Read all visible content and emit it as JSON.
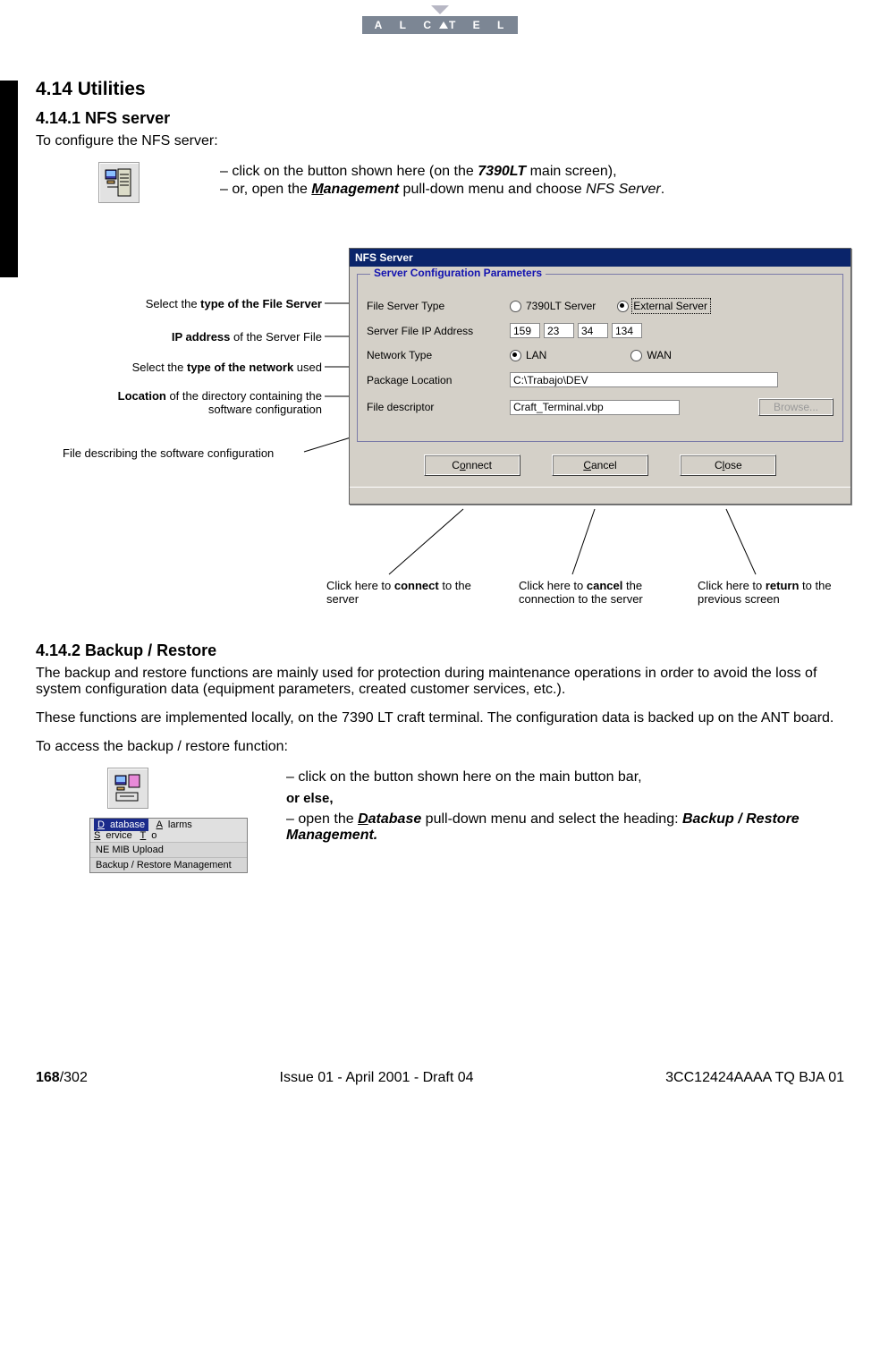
{
  "brand": "A L C A T E L",
  "section": {
    "heading_414": "4.14 Utilities",
    "heading_4141": "4.14.1   NFS server",
    "intro_4141": "To configure the NFS server:",
    "bullet_4141_a_pre": "click on the button shown here (on the ",
    "bullet_4141_a_bold": "7390LT",
    "bullet_4141_a_post": " main screen),",
    "bullet_4141_b_pre": "or, open the ",
    "bullet_4141_b_bold": "Management",
    "bullet_4141_b_post": " pull-down menu and choose ",
    "bullet_4141_b_ital": "NFS Server",
    "bullet_4141_b_end": ".",
    "heading_4142": "4.14.2   Backup / Restore",
    "para_4142_a": "The backup and restore functions are mainly used for protection during maintenance operations in order to avoid the loss of system configuration data (equipment parameters, created customer services, etc.).",
    "para_4142_b": "These functions are implemented locally, on the 7390 LT craft terminal. The configuration data is backed up on the ANT board.",
    "para_4142_c": "To access the backup / restore function:",
    "bullet_4142_a": "click on the button shown here on the main button bar,",
    "or_else": "or else,",
    "bullet_4142_b_pre": "open the ",
    "bullet_4142_b_bold1": "Database",
    "bullet_4142_b_mid": " pull-down menu and select the heading: ",
    "bullet_4142_b_bold2": "Backup / Restore Management.",
    "menu_bar": {
      "database": "Database",
      "alarms": "Alarms",
      "service": "Service",
      "to": "To"
    },
    "menu_item1": "NE MIB Upload",
    "menu_item2": "Backup / Restore Management"
  },
  "nfs": {
    "title": "NFS Server",
    "group": "Server Configuration Parameters",
    "labels": {
      "file_server_type": "File Server Type",
      "ip": "Server File IP Address",
      "net": "Network Type",
      "pkg": "Package Location",
      "fd": "File descriptor"
    },
    "radios": {
      "r7390": "7390LT Server",
      "external": "External Server",
      "lan": "LAN",
      "wan": "WAN"
    },
    "ip": {
      "a": "159",
      "b": "23",
      "c": "34",
      "d": "134"
    },
    "pkg_value": "C:\\Trabajo\\DEV",
    "fd_value": "Craft_Terminal.vbp",
    "browse": "Browse...",
    "buttons": {
      "connect": "Connect",
      "cancel": "Cancel",
      "close": "Close"
    }
  },
  "annotations": {
    "a1_pre": "Select the ",
    "a1_b": "type of the File Server",
    "a2_b": "IP address",
    "a2_post": " of the Server File",
    "a3_pre": "Select the ",
    "a3_b": "type of the network",
    "a3_post": " used",
    "a4_b": "Location",
    "a4_post": " of the directory containing the software configuration",
    "a5": "File describing the software configuration",
    "c1_pre": "Click here to ",
    "c1_b": "connect",
    "c1_post": " to the server",
    "c2_pre": "Click here to ",
    "c2_b": "cancel",
    "c2_post": " the connection to the server",
    "c3_pre": "Click here to ",
    "c3_b": "return",
    "c3_post": " to the previous screen"
  },
  "footer": {
    "page": "168",
    "total": "/302",
    "issue": "Issue 01 - April 2001 - Draft 04",
    "doc": "3CC12424AAAA TQ BJA 01"
  }
}
